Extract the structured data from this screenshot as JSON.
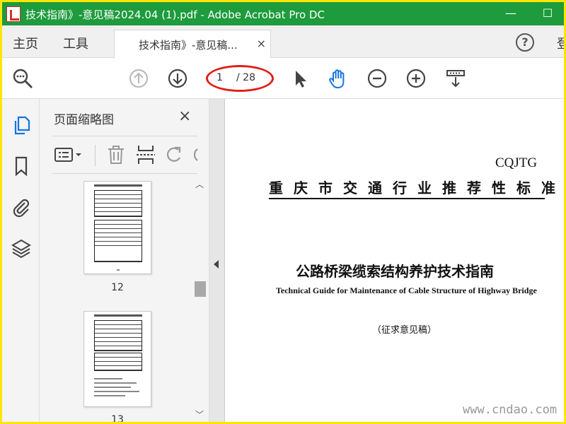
{
  "window": {
    "title": "技术指南》-意见稿2024.04 (1).pdf - Adobe Acrobat Pro DC",
    "minimize": "—",
    "maximize": "☐"
  },
  "tabs": {
    "home": "主页",
    "tools": "工具",
    "document": "技术指南》-意见稿...",
    "close": "×",
    "help": "?",
    "cut_off": "登"
  },
  "toolbar": {
    "current_page": "1",
    "total_pages": "/ 28"
  },
  "panel": {
    "title": "页面缩略图",
    "close": "×",
    "thumbnails": [
      {
        "page": "12"
      },
      {
        "page": "13"
      }
    ]
  },
  "document": {
    "code": "CQJTG",
    "organization": "重庆市交通行业推荐性标准",
    "title": "公路桥梁缆索结构养护技术指南",
    "english_title": "Technical Guide for Maintenance of Cable Structure of Highway Bridge",
    "subtitle": "（征求意见稿）"
  },
  "watermark": "www.cndao.com",
  "colors": {
    "titlebar": "#1d9b3d",
    "frame": "#ffe600",
    "accent_blue": "#1473e6",
    "annotation_red": "#e0201a"
  }
}
